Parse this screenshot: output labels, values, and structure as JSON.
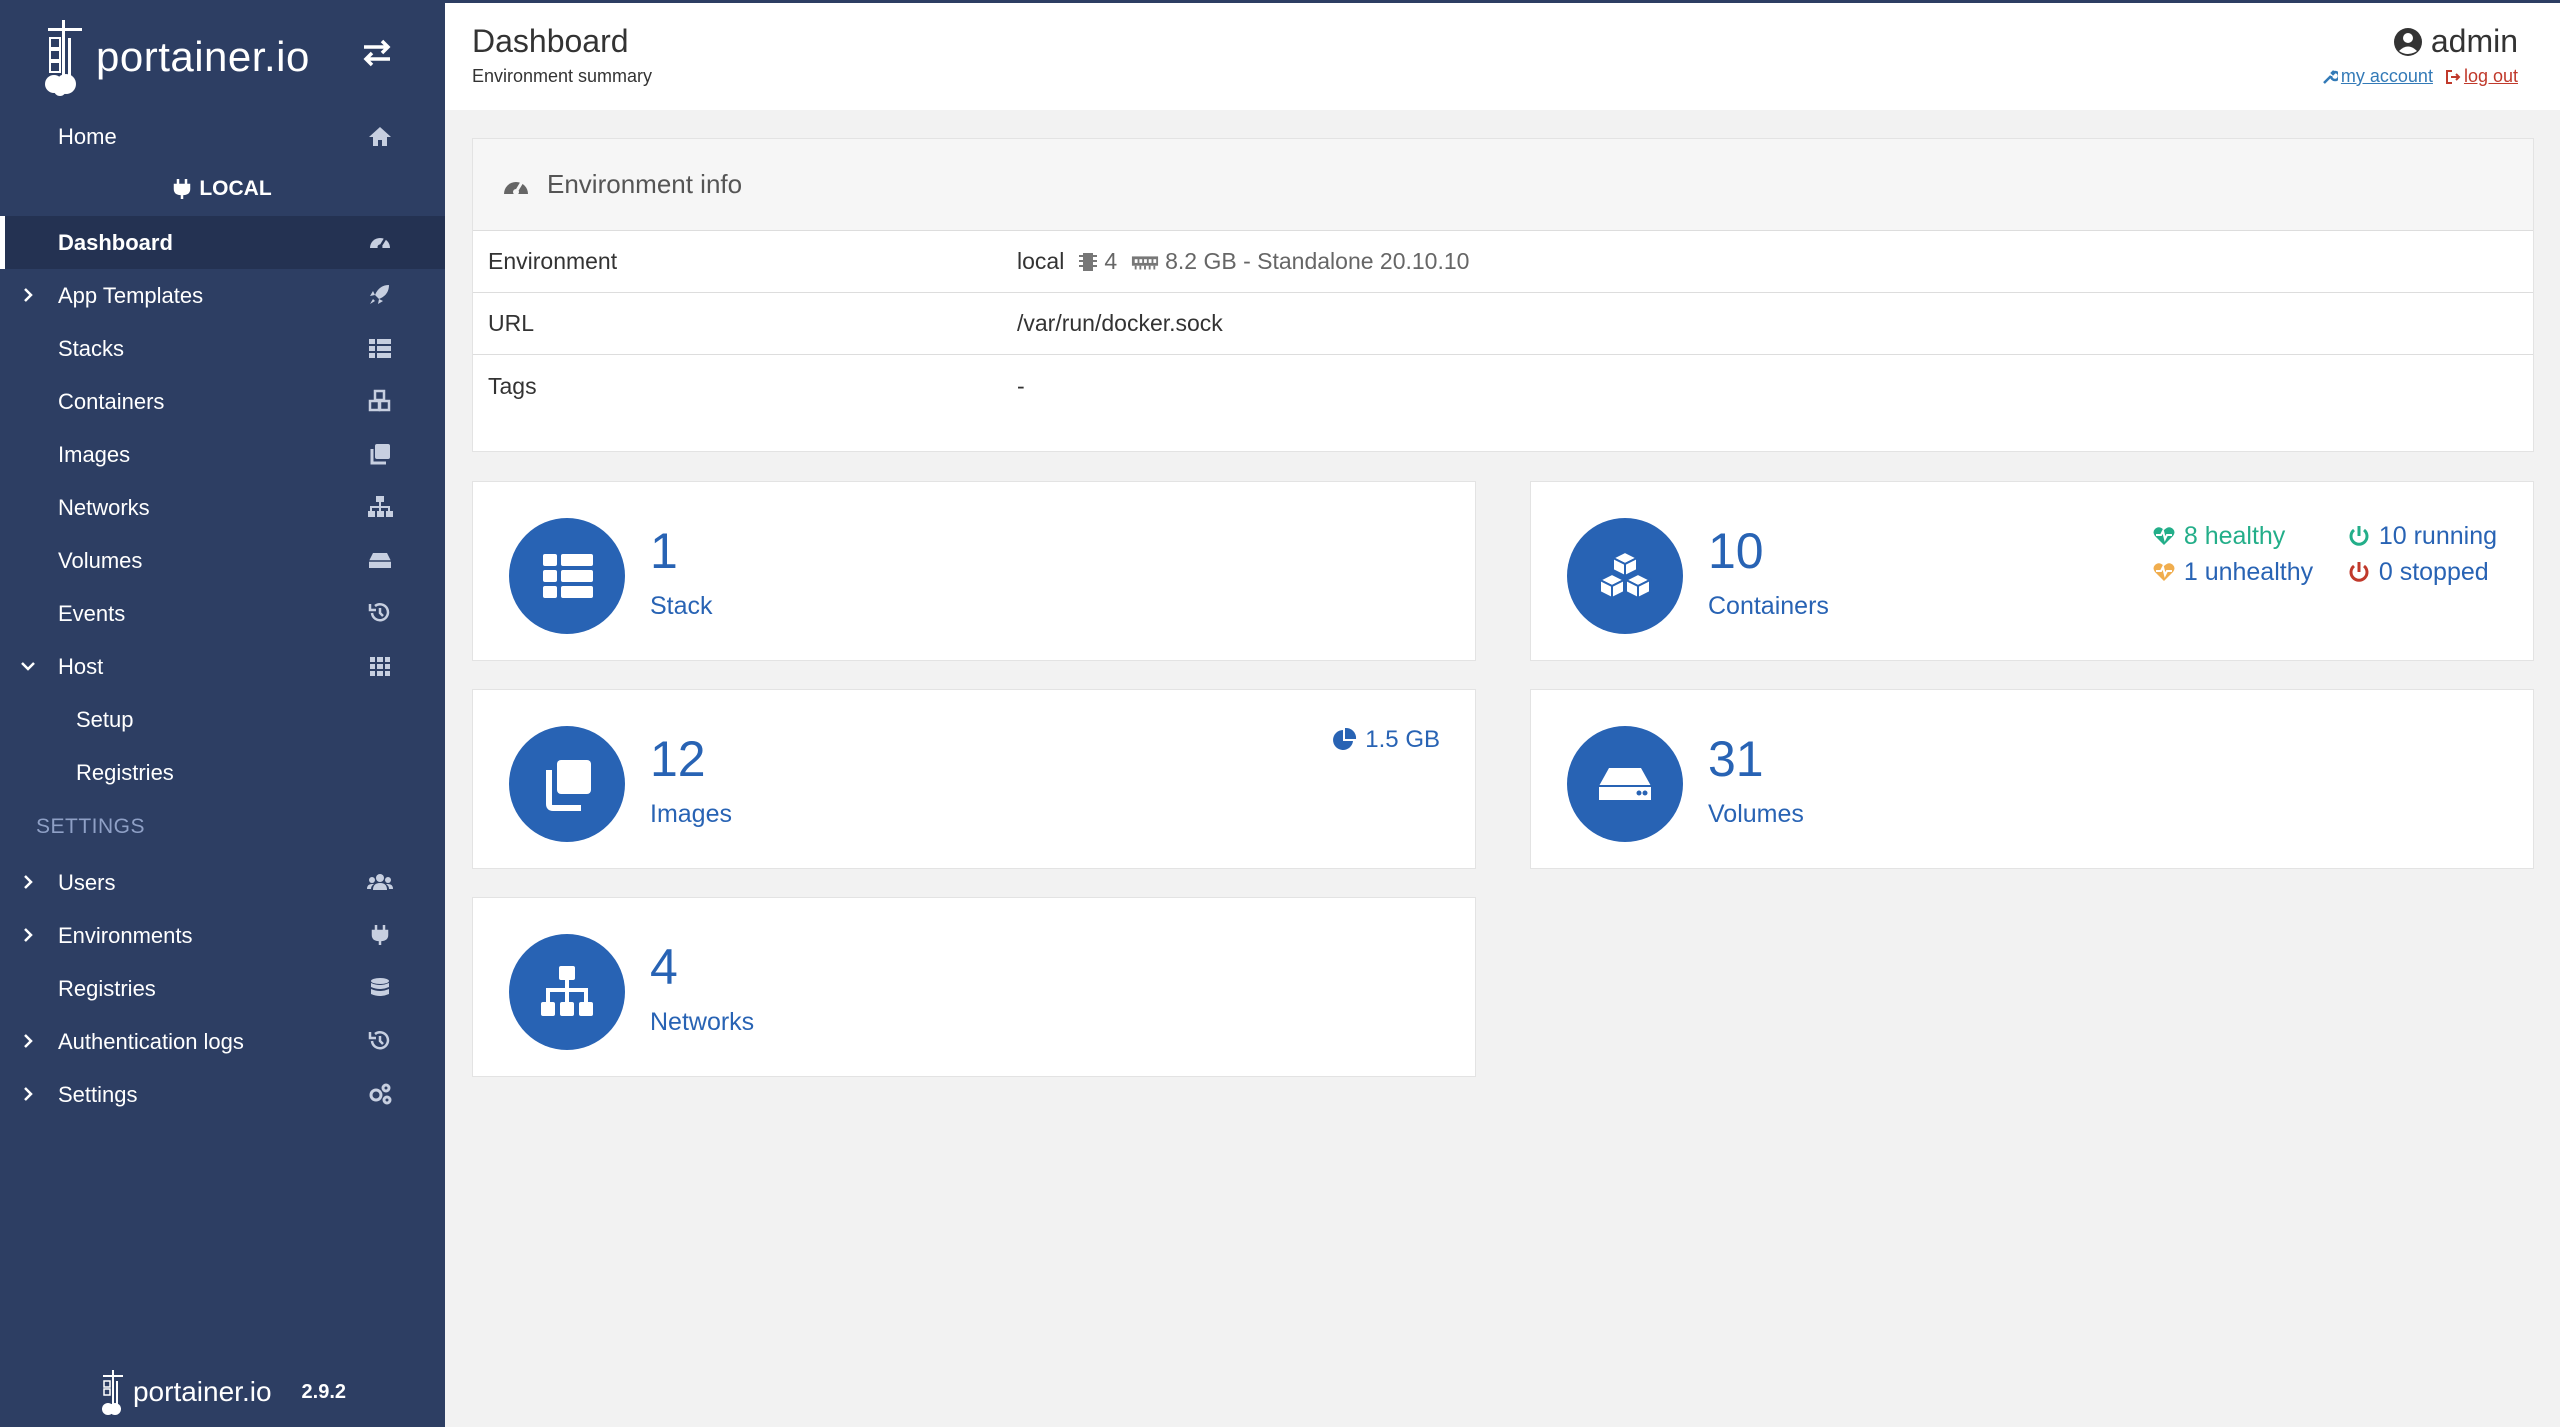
{
  "brand": {
    "name": "portainer.io"
  },
  "sidebar": {
    "home": "Home",
    "environment": "LOCAL",
    "items": [
      {
        "label": "Dashboard",
        "icon": "tachometer-icon"
      },
      {
        "label": "App Templates",
        "icon": "rocket-icon"
      },
      {
        "label": "Stacks",
        "icon": "th-list-icon"
      },
      {
        "label": "Containers",
        "icon": "cubes-icon"
      },
      {
        "label": "Images",
        "icon": "clone-icon"
      },
      {
        "label": "Networks",
        "icon": "sitemap-icon"
      },
      {
        "label": "Volumes",
        "icon": "hdd-icon"
      },
      {
        "label": "Events",
        "icon": "history-icon"
      },
      {
        "label": "Host",
        "icon": "th-icon"
      },
      {
        "label": "Setup"
      },
      {
        "label": "Registries"
      }
    ],
    "settings_title": "SETTINGS",
    "settings_items": [
      {
        "label": "Users",
        "icon": "users-icon"
      },
      {
        "label": "Environments",
        "icon": "plug-icon"
      },
      {
        "label": "Registries",
        "icon": "database-icon"
      },
      {
        "label": "Authentication logs",
        "icon": "history-icon"
      },
      {
        "label": "Settings",
        "icon": "cogs-icon"
      }
    ],
    "footer": {
      "brand": "portainer.io",
      "version": "2.9.2"
    }
  },
  "header": {
    "title": "Dashboard",
    "subtitle": "Environment summary",
    "user": "admin",
    "my_account": "my account",
    "log_out": "log out"
  },
  "env_info": {
    "title": "Environment info",
    "rows": [
      {
        "key": "Environment",
        "name": "local",
        "cpu": "4",
        "memory": "8.2 GB - Standalone 20.10.10"
      },
      {
        "key": "URL",
        "value": "/var/run/docker.sock"
      },
      {
        "key": "Tags",
        "value": "-"
      }
    ]
  },
  "cards": {
    "stacks": {
      "count": "1",
      "label": "Stack"
    },
    "containers": {
      "count": "10",
      "label": "Containers",
      "healthy": "8 healthy",
      "unhealthy": "1 unhealthy",
      "running": "10 running",
      "stopped": "0 stopped"
    },
    "images": {
      "count": "12",
      "label": "Images",
      "size": "1.5 GB"
    },
    "volumes": {
      "count": "31",
      "label": "Volumes"
    },
    "networks": {
      "count": "4",
      "label": "Networks"
    }
  },
  "colors": {
    "sidebar": "#2d3e63",
    "accent": "#2863b4",
    "healthy": "#23ae89",
    "unhealthy": "#f0ad4e",
    "stopped": "#c0392b"
  }
}
